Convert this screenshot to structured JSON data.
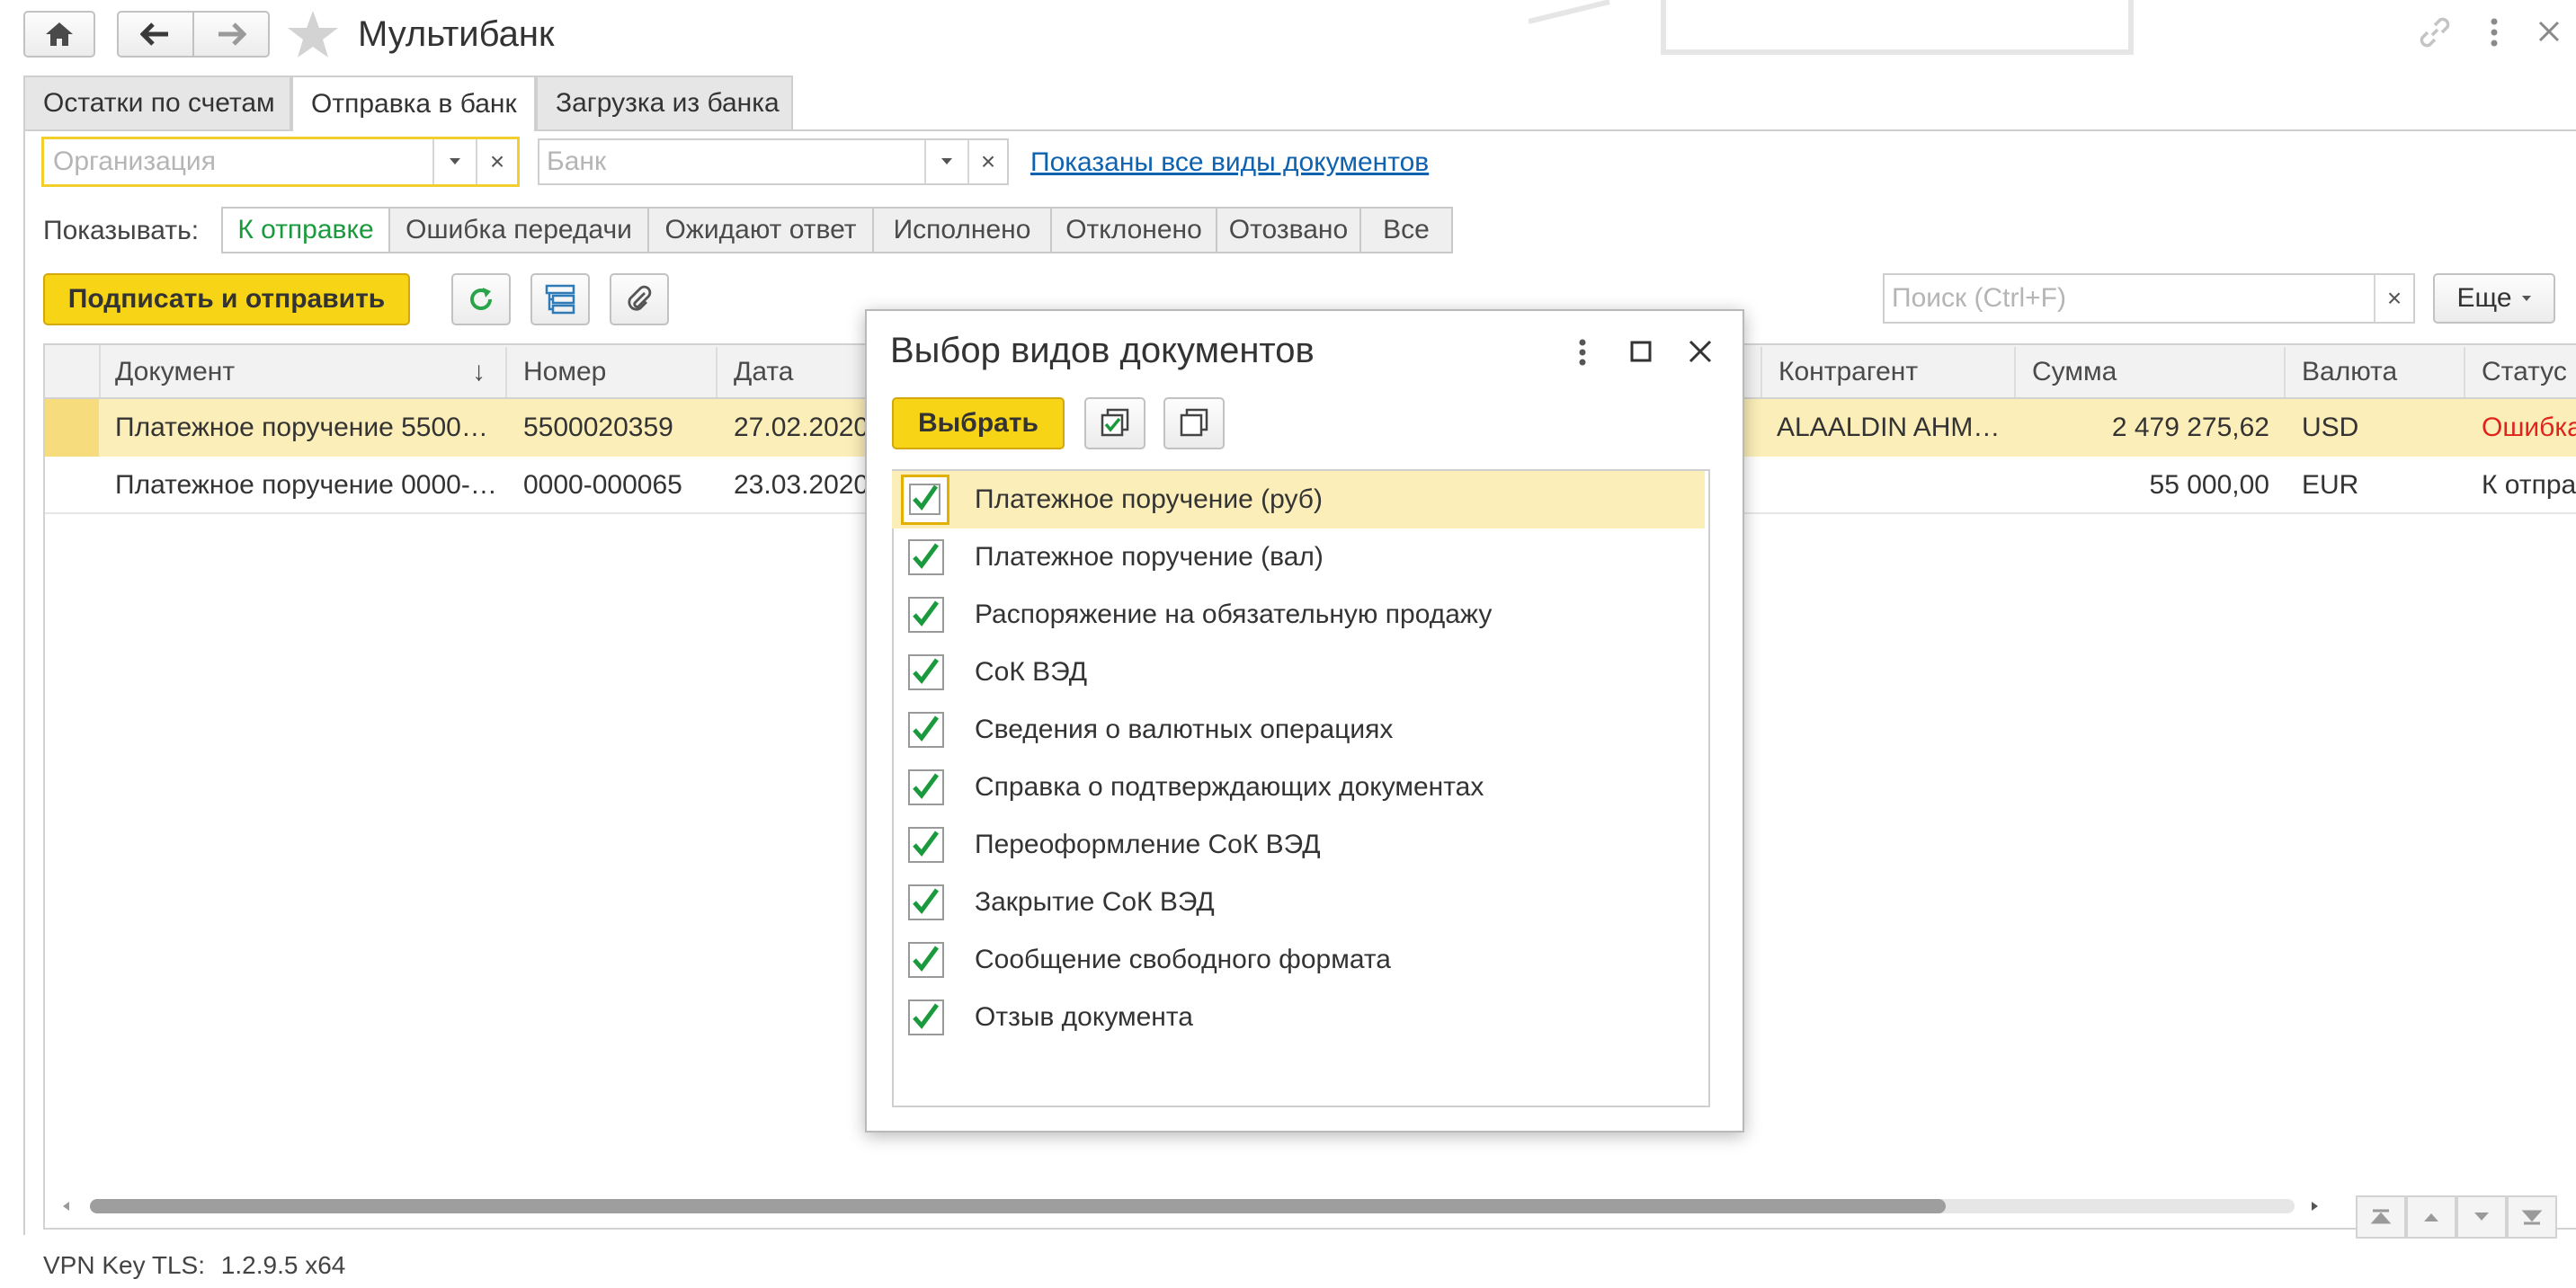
{
  "window": {
    "title": "Мультибанк",
    "icons": [
      "home-icon",
      "back-arrow-icon",
      "forward-arrow-icon",
      "star-icon",
      "link-icon",
      "more-vertical-icon",
      "close-icon"
    ]
  },
  "tabs": [
    {
      "label": "Остатки по счетам",
      "active": false
    },
    {
      "label": "Отправка в банк",
      "active": true
    },
    {
      "label": "Загрузка из банка",
      "active": false
    }
  ],
  "filters": {
    "organization_placeholder": "Организация",
    "bank_placeholder": "Банк",
    "doc_types_link": "Показаны все виды документов",
    "clear": "×"
  },
  "show": {
    "label": "Показывать:",
    "options": [
      {
        "label": "К отправке",
        "active": true
      },
      {
        "label": "Ошибка передачи",
        "active": false
      },
      {
        "label": "Ожидают ответ",
        "active": false
      },
      {
        "label": "Исполнено",
        "active": false
      },
      {
        "label": "Отклонено",
        "active": false
      },
      {
        "label": "Отозвано",
        "active": false
      },
      {
        "label": "Все",
        "active": false
      }
    ]
  },
  "toolbar": {
    "sign_send": "Подписать и отправить",
    "search_placeholder": "Поиск (Ctrl+F)",
    "more": "Еще",
    "clear": "×"
  },
  "table": {
    "columns": [
      "Документ",
      "Номер",
      "Дата",
      "Контрагент",
      "Сумма",
      "Валюта",
      "Статус"
    ],
    "sort_indicator": "↓",
    "rows": [
      {
        "doc": "Платежное поручение 5500…",
        "number": "5500020359",
        "date": "27.02.2020",
        "counterparty": "ALAALDIN AHM…",
        "sum": "2 479 275,62",
        "currency": "USD",
        "status": "Ошибка",
        "status_color": "#e0241c",
        "selected": true
      },
      {
        "doc": "Платежное поручение 0000-…",
        "number": "0000-000065",
        "date": "23.03.2020",
        "counterparty": "",
        "sum": "55 000,00",
        "currency": "EUR",
        "status": "К отправке",
        "status_color": "#333333",
        "selected": false
      }
    ]
  },
  "dialog": {
    "title": "Выбор видов документов",
    "select_button": "Выбрать",
    "items": [
      {
        "label": "Платежное поручение (руб)",
        "checked": true
      },
      {
        "label": "Платежное поручение (вал)",
        "checked": true
      },
      {
        "label": "Распоряжение на обязательную продажу",
        "checked": true
      },
      {
        "label": "СоК ВЭД",
        "checked": true
      },
      {
        "label": "Сведения о валютных операциях",
        "checked": true
      },
      {
        "label": "Справка о подтверждающих документах",
        "checked": true
      },
      {
        "label": "Переоформление СоК ВЭД",
        "checked": true
      },
      {
        "label": "Закрытие СоК ВЭД",
        "checked": true
      },
      {
        "label": "Сообщение свободного формата",
        "checked": true
      },
      {
        "label": "Отзыв документа",
        "checked": true
      }
    ]
  },
  "footer": {
    "vpn_label": "VPN Key TLS:",
    "vpn_version": "1.2.9.5 x64"
  },
  "colors": {
    "accent_yellow": "#f7d516",
    "selected_row": "#fbeeb8",
    "check_green": "#1a9a3c",
    "link_blue": "#0e62b0",
    "error_red": "#e0241c"
  }
}
